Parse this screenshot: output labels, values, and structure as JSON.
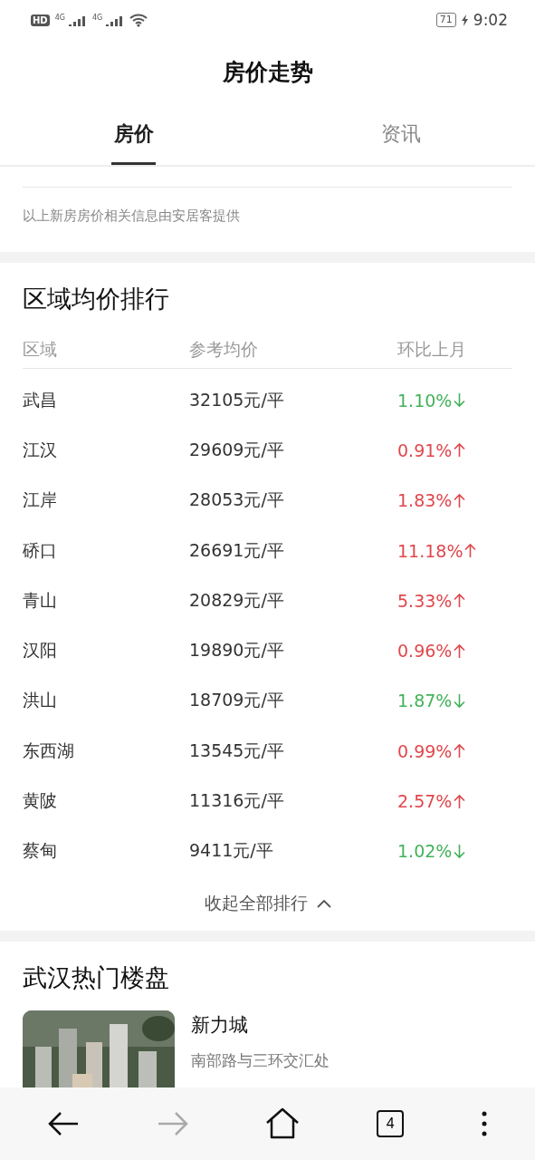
{
  "status_bar": {
    "hd_badge": "HD",
    "network_labels": [
      "4G",
      "4G"
    ],
    "battery": "71",
    "time": "9:02"
  },
  "header": {
    "title": "房价走势"
  },
  "tabs": [
    {
      "label": "房价",
      "selected": true
    },
    {
      "label": "资讯",
      "selected": false
    }
  ],
  "source_note": "以上新房房价相关信息由安居客提供",
  "ranking": {
    "title": "区域均价排行",
    "columns": [
      "区域",
      "参考均价",
      "环比上月"
    ],
    "rows": [
      {
        "area": "武昌",
        "price": "32105元/平",
        "change": "1.10%",
        "rising": false
      },
      {
        "area": "江汉",
        "price": "29609元/平",
        "change": "0.91%",
        "rising": true
      },
      {
        "area": "江岸",
        "price": "28053元/平",
        "change": "1.83%",
        "rising": true
      },
      {
        "area": "硚口",
        "price": "26691元/平",
        "change": "11.18%",
        "rising": true
      },
      {
        "area": "青山",
        "price": "20829元/平",
        "change": "5.33%",
        "rising": true
      },
      {
        "area": "汉阳",
        "price": "19890元/平",
        "change": "0.96%",
        "rising": true
      },
      {
        "area": "洪山",
        "price": "18709元/平",
        "change": "1.87%",
        "rising": false
      },
      {
        "area": "东西湖",
        "price": "13545元/平",
        "change": "0.99%",
        "rising": true
      },
      {
        "area": "黄陂",
        "price": "11316元/平",
        "change": "2.57%",
        "rising": true
      },
      {
        "area": "蔡甸",
        "price": "9411元/平",
        "change": "1.02%",
        "rising": false
      }
    ],
    "collapse_link": "收起全部排行"
  },
  "hot_projects": {
    "title": "武汉热门楼盘",
    "items": [
      {
        "name": "新力城",
        "address": "南部路与三环交汇处"
      }
    ]
  },
  "bottom_nav": {
    "tab_count": "4",
    "forward_disabled": true
  }
}
